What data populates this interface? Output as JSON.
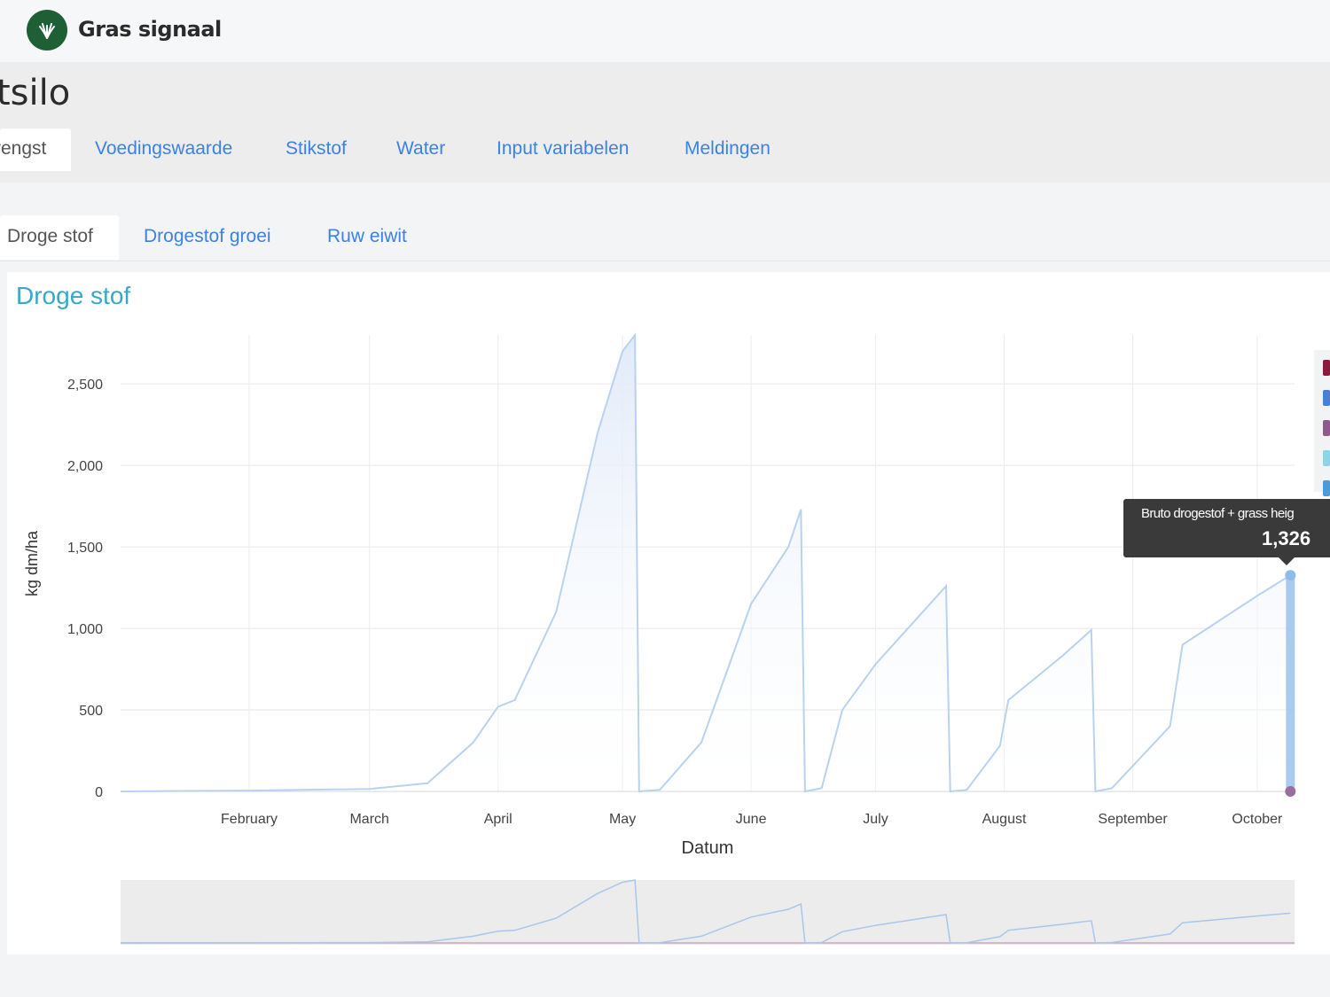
{
  "app": {
    "name": "Gras signaal",
    "logo_icon": "grass-icon"
  },
  "page": {
    "title": "tsilo"
  },
  "tabs": [
    {
      "label": "rengst",
      "active": true
    },
    {
      "label": "Voedingswaarde",
      "active": false
    },
    {
      "label": "Stikstof",
      "active": false
    },
    {
      "label": "Water",
      "active": false
    },
    {
      "label": "Input variabelen",
      "active": false
    },
    {
      "label": "Meldingen",
      "active": false
    }
  ],
  "subtabs": [
    {
      "label": "Droge stof",
      "active": true
    },
    {
      "label": "Drogestof groei",
      "active": false
    },
    {
      "label": "Ruw eiwit",
      "active": false
    }
  ],
  "panel": {
    "title": "Droge stof"
  },
  "tooltip": {
    "label": "Bruto drogestof + grass heig",
    "value": "1,326"
  },
  "legend_colors": [
    "#8b1a3c",
    "#4a7fd6",
    "#8e5a8c",
    "#8fd3e6",
    "#4a9bd6"
  ],
  "colors": {
    "series_line": "#b8d2ef",
    "series_fill": "#dfe9f8",
    "point": "#9a6fa0",
    "accent": "#39a8c6"
  },
  "chart_data": {
    "type": "area",
    "title": "",
    "xlabel": "Datum",
    "ylabel": "kg dm/ha",
    "ylim": [
      0,
      2800
    ],
    "yticks": [
      0,
      500,
      1000,
      1500,
      2000,
      2500
    ],
    "ytick_labels": [
      "0",
      "500",
      "1,000",
      "1,500",
      "2,000",
      "2,500"
    ],
    "xticks": [
      "February",
      "March",
      "April",
      "May",
      "June",
      "July",
      "August",
      "September",
      "October"
    ],
    "grid": true,
    "series": [
      {
        "name": "Bruto drogestof + grass heig",
        "points": [
          [
            "2024-01-01",
            0
          ],
          [
            "2024-02-01",
            5
          ],
          [
            "2024-03-01",
            15
          ],
          [
            "2024-03-15",
            50
          ],
          [
            "2024-03-26",
            300
          ],
          [
            "2024-04-01",
            520
          ],
          [
            "2024-04-05",
            560
          ],
          [
            "2024-04-15",
            1100
          ],
          [
            "2024-04-25",
            2200
          ],
          [
            "2024-05-01",
            2700
          ],
          [
            "2024-05-04",
            2800
          ],
          [
            "2024-05-05",
            0
          ],
          [
            "2024-05-10",
            10
          ],
          [
            "2024-05-20",
            300
          ],
          [
            "2024-06-01",
            1150
          ],
          [
            "2024-06-10",
            1500
          ],
          [
            "2024-06-13",
            1730
          ],
          [
            "2024-06-14",
            0
          ],
          [
            "2024-06-18",
            20
          ],
          [
            "2024-06-23",
            500
          ],
          [
            "2024-07-01",
            780
          ],
          [
            "2024-07-18",
            1260
          ],
          [
            "2024-07-19",
            0
          ],
          [
            "2024-07-23",
            10
          ],
          [
            "2024-07-31",
            280
          ],
          [
            "2024-08-02",
            560
          ],
          [
            "2024-08-15",
            830
          ],
          [
            "2024-08-22",
            990
          ],
          [
            "2024-08-23",
            0
          ],
          [
            "2024-08-27",
            20
          ],
          [
            "2024-09-10",
            400
          ],
          [
            "2024-09-13",
            900
          ],
          [
            "2024-10-01",
            1200
          ],
          [
            "2024-10-09",
            1326
          ]
        ]
      }
    ],
    "highlight": {
      "x": "2024-10-09",
      "y": 1326
    }
  }
}
